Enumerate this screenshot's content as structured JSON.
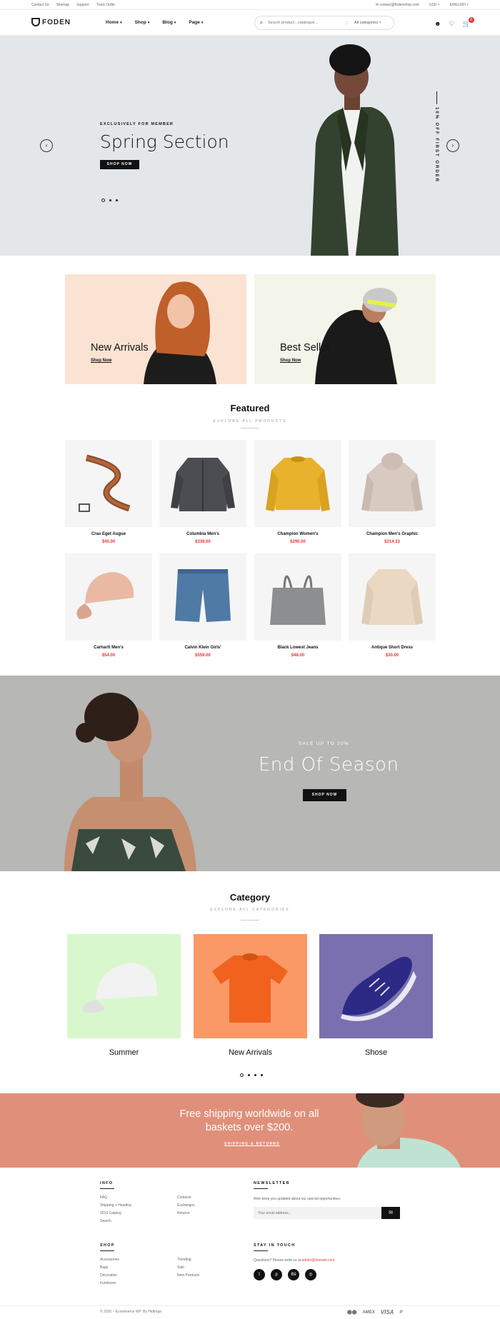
{
  "topbar": {
    "links": [
      "Contact Us",
      "Sitemap",
      "Support",
      "Track Order"
    ],
    "email": "contact@fodenshop.com",
    "currency": "USD",
    "language": "ENGLISH"
  },
  "header": {
    "logo": "FODEN",
    "nav": [
      "Home",
      "Shop",
      "Blog",
      "Page"
    ],
    "search_placeholder": "Search product , catalogue...",
    "search_category": "All categories",
    "cart_count": "0"
  },
  "hero": {
    "eyebrow": "EXCLUSIVELY FOR MEMBER",
    "title": "Spring Section",
    "button": "SHOP NOW",
    "side_text": "10% OFF FIRST ORDER"
  },
  "banners": [
    {
      "title": "New Arrivals",
      "link": "Shop Now"
    },
    {
      "title": "Best Seller",
      "link": "Shop Now"
    }
  ],
  "featured": {
    "title": "Featured",
    "subtitle": "EXPLORE ALL PRODUCTS",
    "products": [
      {
        "name": "Cras Eget Augue",
        "price": "$45.00"
      },
      {
        "name": "Columbia Men's",
        "price": "$339.00"
      },
      {
        "name": "Champion Women's",
        "price": "$290.00"
      },
      {
        "name": "Champion Men's Graphic",
        "price": "$314.33"
      },
      {
        "name": "Carhartt Men's",
        "price": "$54.00"
      },
      {
        "name": "Calvin Klein Girls'",
        "price": "$559.00"
      },
      {
        "name": "Black Lowest Jeans",
        "price": "$48.00"
      },
      {
        "name": "Antique Short Dress",
        "price": "$30.00"
      }
    ]
  },
  "season": {
    "eyebrow": "SALE UP TO 20%",
    "title": "End Of Season",
    "button": "SHOP NOW"
  },
  "category": {
    "title": "Category",
    "subtitle": "EXPLORE ALL CATEGORIES",
    "items": [
      {
        "name": "Summer",
        "color": "#d9f7cc"
      },
      {
        "name": "New Arrivals",
        "color": "#fa9866"
      },
      {
        "name": "Shose",
        "color": "#7a70b0"
      }
    ]
  },
  "shipping": {
    "title": "Free shipping worldwide on all baskets over $200.",
    "link": "SHIPPING & RETURNS"
  },
  "footer": {
    "info_title": "INFO",
    "info_col1": [
      "FAQ",
      "Shipping + Heading",
      "2019 Catalog",
      "Search"
    ],
    "info_col2": [
      "Contacts",
      "Exchanges",
      "Returns"
    ],
    "shop_title": "SHOP",
    "shop_col1": [
      "Accessories",
      "Bags",
      "Decoration",
      "Furnitures"
    ],
    "shop_col2": [
      "Trending",
      "Sale",
      "New Products"
    ],
    "newsletter_title": "NEWSLETTER",
    "newsletter_text": "Wee keep you updated about our special opportunities.",
    "newsletter_placeholder": "Your email address...",
    "touch_title": "STAY IN TOUCH",
    "touch_text": "Questions? Please write us at",
    "touch_email": "admin@domain.com",
    "copyright": "© 2020 – Ecommerce WP. By Hidtrogo",
    "payments": [
      "AMEX",
      "VISA",
      "P"
    ]
  },
  "colors": {
    "accent": "#e53935",
    "dark": "#111111",
    "hero_bg": "#e3e7ea",
    "season_bg": "#b7b7b5",
    "shipping_bg": "#e0907a"
  }
}
